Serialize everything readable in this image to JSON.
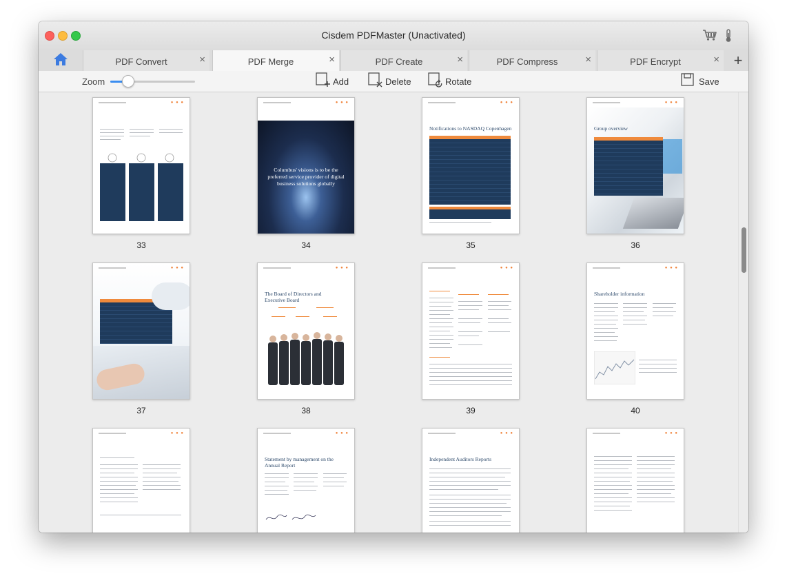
{
  "window": {
    "title": "Cisdem PDFMaster (Unactivated)"
  },
  "titlebar_icons": [
    "cart-icon",
    "thermometer-icon"
  ],
  "tabs": [
    {
      "label": "PDF Convert",
      "active": false
    },
    {
      "label": "PDF Merge",
      "active": true
    },
    {
      "label": "PDF Create",
      "active": false
    },
    {
      "label": "PDF Compress",
      "active": false
    },
    {
      "label": "PDF Encrypt",
      "active": false
    }
  ],
  "toolbar": {
    "zoom_label": "Zoom",
    "zoom_level": 0.2,
    "add_label": "Add",
    "delete_label": "Delete",
    "rotate_label": "Rotate",
    "save_label": "Save"
  },
  "pages": [
    {
      "number": "33"
    },
    {
      "number": "34",
      "heading": "Columbus' visions is to be the preferred service provider of digital business solutions globally"
    },
    {
      "number": "35",
      "heading": "Notifications to NASDAQ Copenhagen"
    },
    {
      "number": "36",
      "heading": "Group overview"
    },
    {
      "number": "37"
    },
    {
      "number": "38",
      "heading": "The Board of Directors and Executive Board"
    },
    {
      "number": "39"
    },
    {
      "number": "40",
      "heading": "Shareholder information"
    },
    {
      "number": ""
    },
    {
      "number": "",
      "heading": "Statement by management on the Annual Report"
    },
    {
      "number": "",
      "heading": "Independent Auditors Reports"
    },
    {
      "number": ""
    }
  ],
  "colors": {
    "accent": "#3b8df0",
    "home_icon": "#3c7be0",
    "page_orange": "#ef8a3c",
    "page_navy": "#1f3b5c"
  }
}
